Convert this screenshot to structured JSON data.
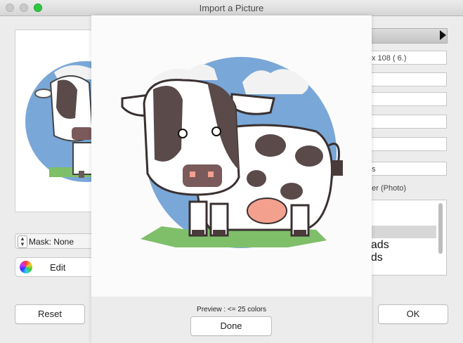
{
  "window": {
    "title": "Import a Picture"
  },
  "left": {
    "mask_label": "Mask: None",
    "edit_label": "Edit"
  },
  "right": {
    "size_text": "x 108 ( 6.)",
    "checkbox_a": "es",
    "checkbox_b": "her (Photo)",
    "list_items": [
      "s",
      "",
      "eads",
      "ads"
    ]
  },
  "footer": {
    "reset_label": "Reset",
    "ok_label": "OK"
  },
  "preview": {
    "caption": "Preview :  <= 25  colors",
    "done_label": "Done"
  },
  "colors": {
    "sky": "#79a7d8",
    "cloud": "#f2f2f2",
    "cow_white": "#ffffff",
    "cow_spot": "#5a4a4a",
    "udder": "#f4a08e",
    "grass": "#7fbf6a",
    "max_button": "#2ec840"
  }
}
